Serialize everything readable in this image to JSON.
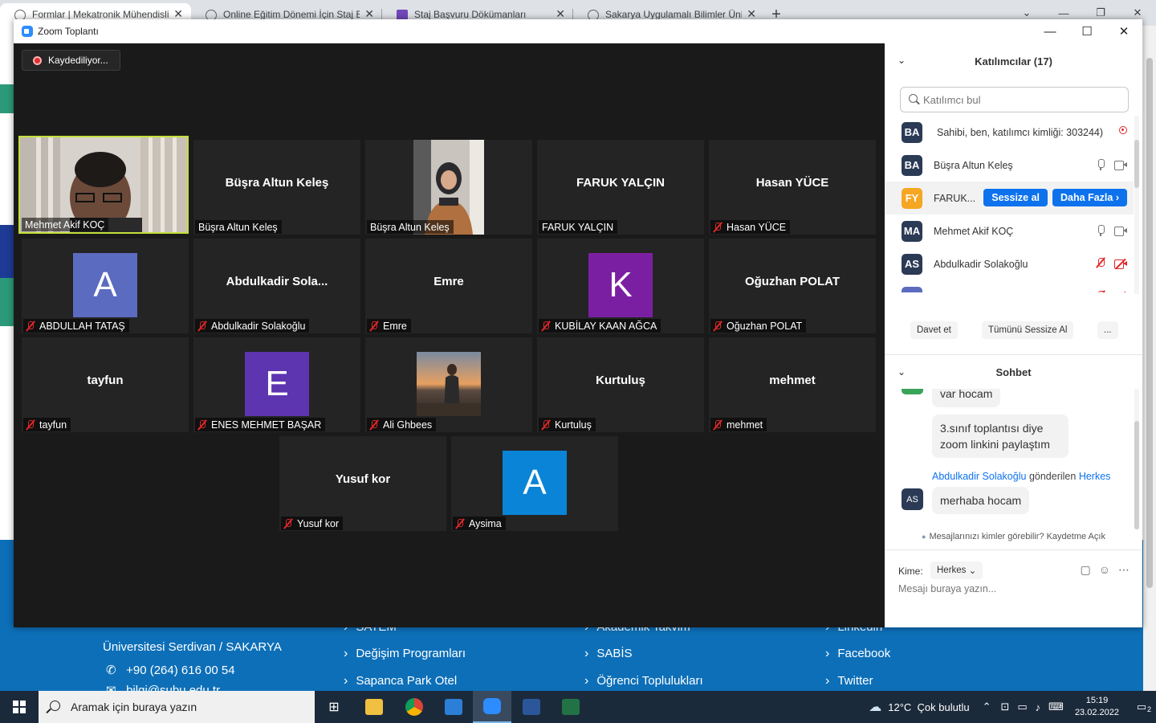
{
  "browser": {
    "tabs": [
      {
        "label": "Formlar | Mekatronik Mühendisliği",
        "icon": "sakarya-icon",
        "active": true
      },
      {
        "label": "Online Eğitim Dönemi İçin Staj Başvuru",
        "icon": "globe-icon",
        "active": false
      },
      {
        "label": "Staj Başvuru Dökümanları",
        "icon": "forms-icon",
        "active": false
      },
      {
        "label": "Sakarya Uygulamalı Bilimler Üniversitesi",
        "icon": "sakarya-icon",
        "active": false
      }
    ],
    "new_tab": "+",
    "footer": {
      "address": "Üniversitesi Serdivan / SAKARYA",
      "phone": "+90 (264) 616 00 54",
      "email": "bilgi@subu.edu.tr",
      "col2": [
        "SATEM",
        "Değişim Programları",
        "Sapanca Park Otel"
      ],
      "col3": [
        "Akademik Takvim",
        "SABİS",
        "Öğrenci Toplulukları"
      ],
      "col4": [
        "Linkedin",
        "Facebook",
        "Twitter"
      ]
    }
  },
  "zoom": {
    "window_title": "Zoom Toplantı",
    "recording_label": "Kaydediliyor...",
    "tiles": [
      {
        "name_center": "",
        "name_tag": "Mehmet Akif KOÇ",
        "muted": false,
        "kind": "video",
        "active": true
      },
      {
        "name_center": "Büşra Altun Keleş",
        "name_tag": "Büşra Altun Keleş",
        "muted": false,
        "kind": "name"
      },
      {
        "name_center": "",
        "name_tag": "Büşra Altun Keleş",
        "muted": false,
        "kind": "video"
      },
      {
        "name_center": "FARUK YALÇIN",
        "name_tag": "FARUK YALÇIN",
        "muted": false,
        "kind": "name"
      },
      {
        "name_center": "Hasan YÜCE",
        "name_tag": "Hasan YÜCE",
        "muted": true,
        "kind": "name"
      },
      {
        "letter": "A",
        "color": "#5b6bc0",
        "name_tag": "ABDULLAH TATAŞ",
        "muted": true,
        "kind": "avatar"
      },
      {
        "name_center": "Abdulkadir  Sola...",
        "name_tag": "Abdulkadir Solakoğlu",
        "muted": true,
        "kind": "name"
      },
      {
        "name_center": "Emre",
        "name_tag": "Emre",
        "muted": true,
        "kind": "name"
      },
      {
        "letter": "K",
        "color": "#7b1fa2",
        "name_tag": "KUBİLAY KAAN AĞCA",
        "muted": true,
        "kind": "avatar"
      },
      {
        "name_center": "Oğuzhan POLAT",
        "name_tag": "Oğuzhan POLAT",
        "muted": true,
        "kind": "name"
      },
      {
        "name_center": "tayfun",
        "name_tag": "tayfun",
        "muted": true,
        "kind": "name"
      },
      {
        "letter": "E",
        "color": "#5e35b1",
        "name_tag": "ENES MEHMET BAŞAR",
        "muted": true,
        "kind": "avatar"
      },
      {
        "name_center": "",
        "name_tag": "Ali Ghbees",
        "muted": true,
        "kind": "photo"
      },
      {
        "name_center": "Kurtuluş",
        "name_tag": "Kurtuluş",
        "muted": true,
        "kind": "name"
      },
      {
        "name_center": "mehmet",
        "name_tag": "mehmet",
        "muted": true,
        "kind": "name"
      },
      {
        "name_center": "Yusuf kor",
        "name_tag": "Yusuf kor",
        "muted": true,
        "kind": "name"
      },
      {
        "letter": "A",
        "color": "#0a84d6",
        "name_tag": "Aysima",
        "muted": true,
        "kind": "avatar"
      }
    ],
    "participants_panel": {
      "title": "Katılımcılar (17)",
      "search_placeholder": "Katılımcı bul",
      "rows": [
        {
          "initials": "BA",
          "color": "#2b3a55",
          "name": "Sahibi, ben, katılımcı kimliği: 303244)"
        },
        {
          "initials": "BA",
          "color": "#2b3a55",
          "name": "Büşra Altun Keleş"
        },
        {
          "initials": "FY",
          "color": "#f5a623",
          "name": "FARUK..."
        },
        {
          "initials": "MA",
          "color": "#2b3a55",
          "name": "Mehmet Akif KOÇ"
        },
        {
          "initials": "AS",
          "color": "#2b3a55",
          "name": "Abdulkadir Solakoğlu"
        }
      ],
      "mute_button": "Sessize al",
      "more_button": "Daha Fazla",
      "invite_button": "Davet et",
      "mute_all_button": "Tümünü Sessize Al",
      "ellipsis_button": "..."
    },
    "chat_panel": {
      "title": "Sohbet",
      "messages": [
        {
          "text": "var hocam"
        },
        {
          "text": "3.sınıf toplantısı diye zoom linkini paylaştım"
        }
      ],
      "sender_name": "Abdulkadir Solakoğlu",
      "sender_mid": "gönderilen",
      "sender_target": "Herkes",
      "last_avatar": "AS",
      "last_message": "merhaba hocam",
      "top_avatar": "HY",
      "privacy_text": "Mesajlarınızı kimler görebilir? Kaydetme Açık",
      "to_label": "Kime:",
      "to_value": "Herkes",
      "input_placeholder": "Mesajı buraya yazın..."
    }
  },
  "taskbar": {
    "search_placeholder": "Aramak için buraya yazın",
    "weather": "12°C  Çok bulutlu",
    "time": "15:19",
    "date": "23.02.2022",
    "notifications": "2"
  }
}
